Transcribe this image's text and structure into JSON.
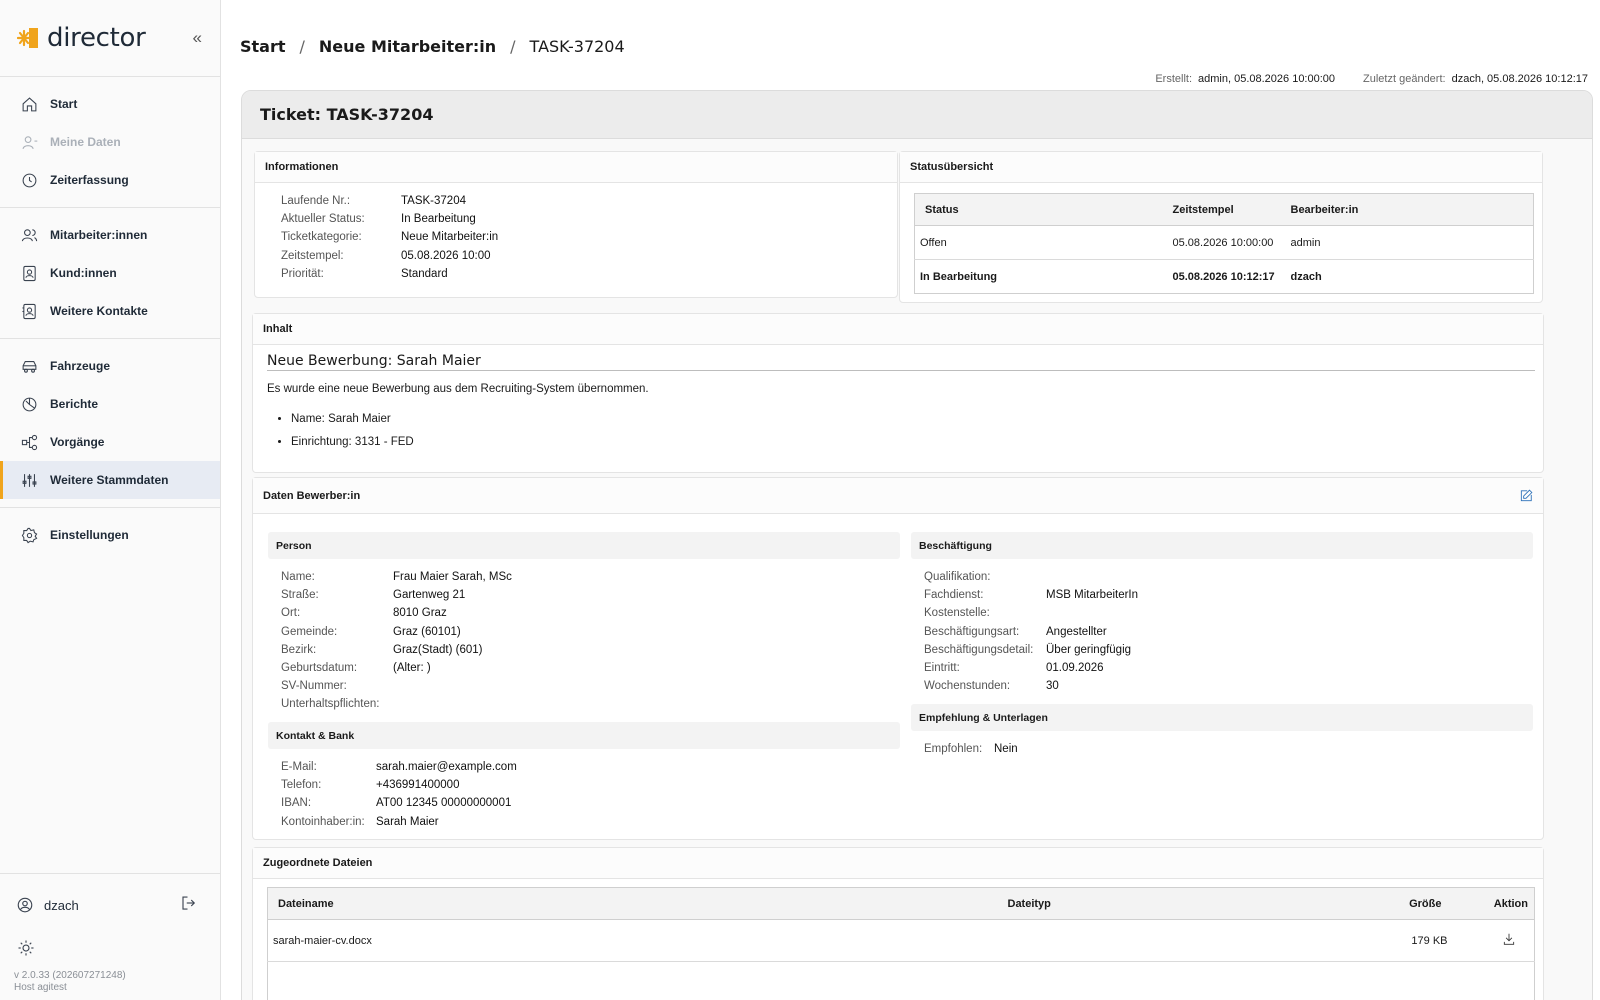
{
  "app": {
    "name": "director"
  },
  "sidebar": {
    "items": [
      {
        "label": "Start",
        "icon": "home-icon"
      },
      {
        "label": "Meine Daten",
        "icon": "user-icon"
      },
      {
        "label": "Zeiterfassung",
        "icon": "clock-icon"
      },
      {
        "label": "Mitarbeiter:innen",
        "icon": "users-icon"
      },
      {
        "label": "Kund:innen",
        "icon": "contact-card-icon"
      },
      {
        "label": "Weitere Kontakte",
        "icon": "contact-card-icon"
      },
      {
        "label": "Fahrzeuge",
        "icon": "car-icon"
      },
      {
        "label": "Berichte",
        "icon": "pie-chart-icon"
      },
      {
        "label": "Vorgänge",
        "icon": "workflow-icon"
      },
      {
        "label": "Weitere Stammdaten",
        "icon": "sliders-icon"
      },
      {
        "label": "Einstellungen",
        "icon": "gear-icon"
      }
    ],
    "user": "dzach",
    "version_line1": "v 2.0.33 (202607271248)",
    "version_line2": "Host agitest"
  },
  "breadcrumb": [
    "Start",
    "Neue Mitarbeiter:in",
    "TASK-37204"
  ],
  "meta": {
    "created_label": "Erstellt:",
    "created_value": "admin, 05.08.2026 10:00:00",
    "changed_label": "Zuletzt geändert:",
    "changed_value": "dzach, 05.08.2026 10:12:17"
  },
  "ticket": {
    "title": "Ticket: TASK-37204",
    "info_title": "Informationen",
    "info": [
      {
        "k": "Laufende Nr.:",
        "v": "TASK-37204"
      },
      {
        "k": "Aktueller Status:",
        "v": "In Bearbeitung"
      },
      {
        "k": "Ticketkategorie:",
        "v": "Neue Mitarbeiter:in"
      },
      {
        "k": "Zeitstempel:",
        "v": "05.08.2026 10:00"
      },
      {
        "k": "Priorität:",
        "v": "Standard"
      }
    ],
    "status_title": "Statusübersicht",
    "status_headers": [
      "Status",
      "Zeitstempel",
      "Bearbeiter:in"
    ],
    "status_rows": [
      [
        "Offen",
        "05.08.2026 10:00:00",
        "admin"
      ],
      [
        "In Bearbeitung",
        "05.08.2026 10:12:17",
        "dzach"
      ]
    ],
    "content_title": "Inhalt",
    "content_heading": "Neue Bewerbung: Sarah Maier",
    "content_text": "Es wurde eine neue Bewerbung aus dem Recruiting-System übernommen.",
    "content_bullets": [
      "Name: Sarah Maier",
      "Einrichtung: 3131 - FED"
    ],
    "applicant_title": "Daten Bewerber:in",
    "person_title": "Person",
    "person": [
      {
        "k": "Name:",
        "v": "Frau Maier Sarah, MSc"
      },
      {
        "k": "Straße:",
        "v": "Gartenweg 21"
      },
      {
        "k": "Ort:",
        "v": "8010 Graz"
      },
      {
        "k": "Gemeinde:",
        "v": "Graz (60101)"
      },
      {
        "k": "Bezirk:",
        "v": "Graz(Stadt) (601)"
      },
      {
        "k": "Geburtsdatum:",
        "v": "(Alter: )"
      },
      {
        "k": "SV-Nummer:",
        "v": ""
      },
      {
        "k": "Unterhaltspflichten:",
        "v": ""
      }
    ],
    "contact_title": "Kontakt & Bank",
    "contact": [
      {
        "k": "E-Mail:",
        "v": "sarah.maier@example.com"
      },
      {
        "k": "Telefon:",
        "v": "+436991400000"
      },
      {
        "k": "IBAN:",
        "v": "AT00 12345 00000000001"
      },
      {
        "k": "Kontoinhaber:in:",
        "v": "Sarah Maier"
      }
    ],
    "employment_title": "Beschäftigung",
    "employment": [
      {
        "k": "Qualifikation:",
        "v": ""
      },
      {
        "k": "Fachdienst:",
        "v": "MSB MitarbeiterIn"
      },
      {
        "k": "Kostenstelle:",
        "v": ""
      },
      {
        "k": "Beschäftigungsart:",
        "v": "Angestellter"
      },
      {
        "k": "Beschäftigungsdetail:",
        "v": "Über geringfügig"
      },
      {
        "k": "Eintritt:",
        "v": "01.09.2026"
      },
      {
        "k": "Wochenstunden:",
        "v": "30"
      }
    ],
    "recommend_title": "Empfehlung & Unterlagen",
    "recommend": [
      {
        "k": "Empfohlen:",
        "v": "Nein"
      }
    ],
    "files_title": "Zugeordnete Dateien",
    "files_headers": [
      "Dateiname",
      "Dateityp",
      "Größe",
      "Aktion"
    ],
    "files": [
      {
        "name": "sarah-maier-cv.docx",
        "type": "",
        "size": "179 KB"
      }
    ]
  },
  "colors": {
    "accent": "#f0a41c",
    "active_bg": "#e7ebf3",
    "link": "#2a6fb8"
  }
}
